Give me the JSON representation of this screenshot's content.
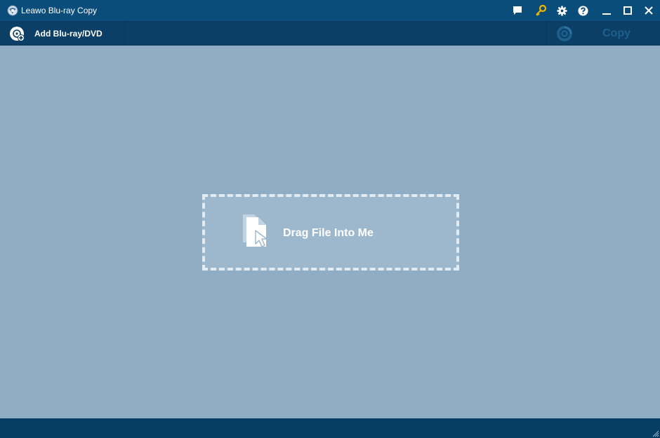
{
  "window": {
    "title": "Leawo Blu-ray Copy",
    "app_icon": "leawo-logo-icon"
  },
  "titlebar_buttons": [
    {
      "name": "feedback-button",
      "icon": "chat-icon"
    },
    {
      "name": "register-button",
      "icon": "key-icon",
      "color": "#f0b400"
    },
    {
      "name": "settings-button",
      "icon": "gear-icon"
    },
    {
      "name": "help-button",
      "icon": "help-icon"
    },
    {
      "name": "minimize-button",
      "icon": "minimize-icon"
    },
    {
      "name": "maximize-button",
      "icon": "maximize-icon"
    },
    {
      "name": "close-button",
      "icon": "close-icon"
    }
  ],
  "toolbar": {
    "add_label": "Add Blu-ray/DVD",
    "add_icon": "add-disc-icon",
    "copy_label": "Copy",
    "copy_icon": "disc-burn-icon",
    "copy_enabled": false
  },
  "dropzone": {
    "label": "Drag File Into Me",
    "icon": "file-drag-icon"
  },
  "colors": {
    "titlebar": "#0a4c7a",
    "toolbar": "#0b3f66",
    "workspace": "#8fadc4",
    "statusbar": "#063d63",
    "accent_key": "#f0b400"
  }
}
